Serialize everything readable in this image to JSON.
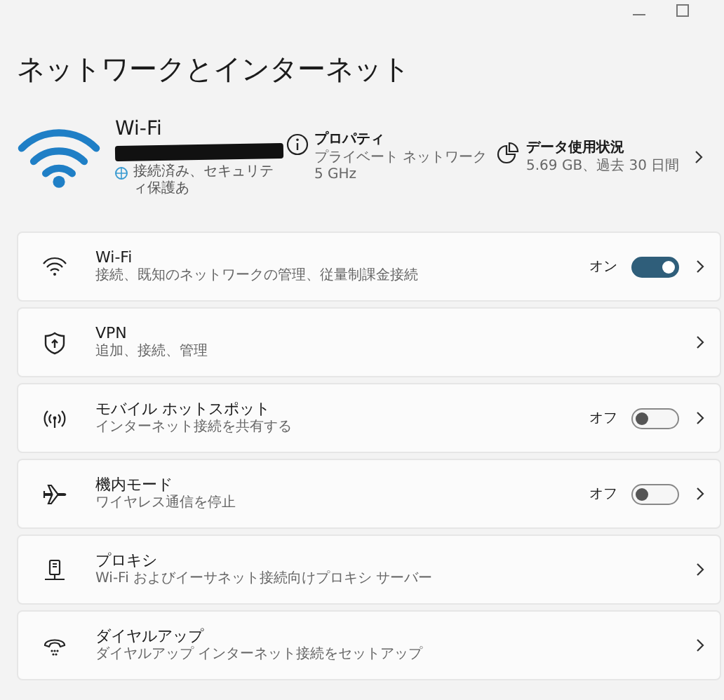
{
  "title": "ネットワークとインターネット",
  "hero": {
    "name": "Wi-Fi",
    "status": "接続済み、セキュリティ保護あ",
    "properties": {
      "title": "プロパティ",
      "lines": [
        "プライベート ネットワーク",
        "5 GHz"
      ]
    },
    "data_usage": {
      "title": "データ使用状況",
      "detail": "5.69 GB、過去 30 日間"
    }
  },
  "items": [
    {
      "kind": "toggle",
      "title": "Wi-Fi",
      "subtitle": "接続、既知のネットワークの管理、従量制課金接続",
      "state_label": "オン",
      "on": true
    },
    {
      "kind": "link",
      "title": "VPN",
      "subtitle": "追加、接続、管理"
    },
    {
      "kind": "toggle",
      "title": "モバイル ホットスポット",
      "subtitle": "インターネット接続を共有する",
      "state_label": "オフ",
      "on": false
    },
    {
      "kind": "toggle",
      "title": "機内モード",
      "subtitle": "ワイヤレス通信を停止",
      "state_label": "オフ",
      "on": false
    },
    {
      "kind": "link",
      "title": "プロキシ",
      "subtitle": "Wi-Fi およびイーサネット接続向けプロキシ サーバー"
    },
    {
      "kind": "link",
      "title": "ダイヤルアップ",
      "subtitle": "ダイヤルアップ インターネット接続をセットアップ"
    }
  ]
}
